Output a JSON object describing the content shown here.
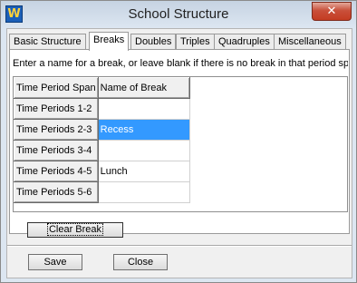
{
  "window": {
    "title": "School Structure",
    "close_glyph": "✕",
    "app_icon_glyph": "W"
  },
  "tabs": [
    {
      "label": "Basic Structure",
      "active": false
    },
    {
      "label": "Breaks",
      "active": true
    },
    {
      "label": "Doubles",
      "active": false
    },
    {
      "label": "Triples",
      "active": false
    },
    {
      "label": "Quadruples",
      "active": false
    },
    {
      "label": "Miscellaneous",
      "active": false
    }
  ],
  "breaks_panel": {
    "instructions": "Enter a name for a break, or leave blank if there is no break in that period span",
    "grid": {
      "headers": [
        "Time Period Span",
        "Name of Break"
      ],
      "rows": [
        {
          "span": "Time Periods 1-2",
          "name": ""
        },
        {
          "span": "Time Periods 2-3",
          "name": "Recess",
          "selected": true
        },
        {
          "span": "Time Periods 3-4",
          "name": ""
        },
        {
          "span": "Time Periods 4-5",
          "name": "Lunch"
        },
        {
          "span": "Time Periods 5-6",
          "name": ""
        }
      ]
    },
    "clear_button": "Clear Break"
  },
  "footer": {
    "save_label": "Save",
    "close_label": "Close"
  },
  "colors": {
    "selection": "#3399ff",
    "close_button": "#c43c22"
  }
}
